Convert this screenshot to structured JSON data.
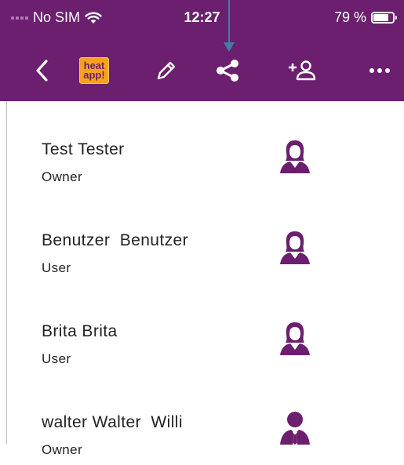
{
  "status_bar": {
    "carrier": "No SIM",
    "time": "12:27",
    "battery_percent": "79 %",
    "battery_level": 0.79
  },
  "toolbar": {
    "logo_line1": "heat",
    "logo_line2": "app!",
    "icons": [
      "back-chevron-icon",
      "app-logo",
      "edit-pencil-icon",
      "share-icon",
      "add-user-icon",
      "more-icon"
    ]
  },
  "users": [
    {
      "name": "Test Tester",
      "role": "Owner",
      "avatar": "female-user-icon"
    },
    {
      "name": "Benutzer  Benutzer",
      "role": "User",
      "avatar": "female-user-icon"
    },
    {
      "name": "Brita Brita",
      "role": "User",
      "avatar": "female-user-icon"
    },
    {
      "name": "walter Walter  Willi",
      "role": "Owner",
      "avatar": "male-user-icon"
    }
  ],
  "colors": {
    "header": "#6b1f6e",
    "accent_icon": "#6b1f6e",
    "logo_bg": "#f6a21b",
    "annotation_arrow": "#3e7fa7"
  }
}
